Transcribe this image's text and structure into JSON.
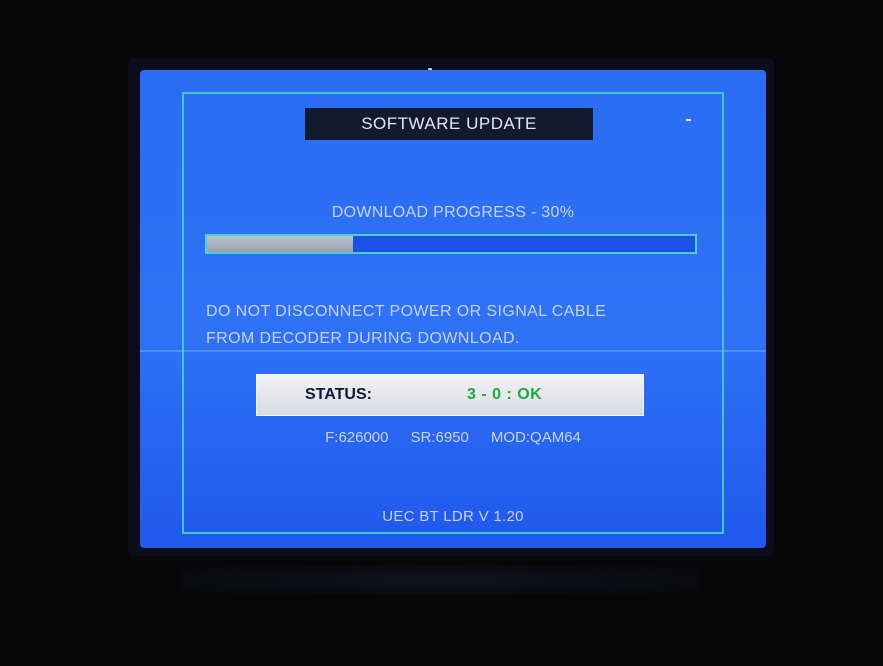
{
  "screen": {
    "title": "SOFTWARE UPDATE",
    "progress": {
      "label": "DOWNLOAD PROGRESS -  30%",
      "fraction": 0.3
    },
    "warning_lines": [
      "DO NOT DISCONNECT POWER OR SIGNAL CABLE",
      "FROM DECODER DURING DOWNLOAD."
    ],
    "status": {
      "label": "STATUS:",
      "value": "3 - 0 : OK"
    },
    "tuning": {
      "frequency": "F:626000",
      "symbol_rate": "SR:6950",
      "modulation": "MOD:QAM64"
    },
    "version": "UEC BT LDR V 1.20"
  },
  "colors": {
    "screen_blue": "#2f72f6",
    "panel_border": "#3fc7c2",
    "status_ok": "#1faa3a",
    "title_bar": "#121a2e"
  }
}
